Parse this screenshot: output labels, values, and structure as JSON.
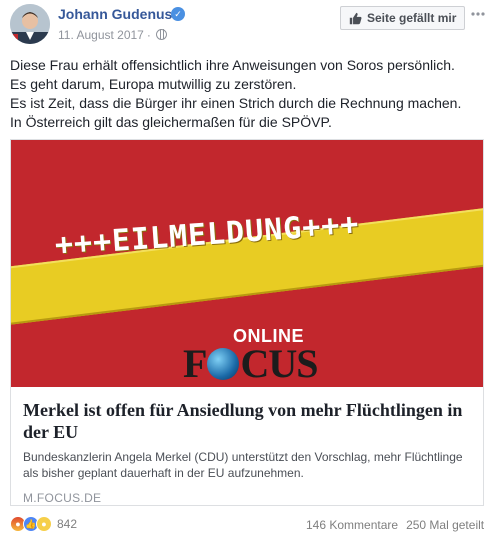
{
  "post": {
    "author": "Johann Gudenus",
    "date": "11. August 2017",
    "meta_separator": "·",
    "like_page_label": "Seite gefällt mir",
    "text_lines": [
      "Diese Frau erhält offensichtlich ihre Anweisungen von Soros persönlich.",
      "Es geht darum, Europa mutwillig zu zerstören.",
      "Es ist Zeit, dass die Bürger ihr einen Strich durch die Rechnung machen.",
      "In Österreich gilt das gleichermaßen für die SPÖVP."
    ]
  },
  "link_card": {
    "image": {
      "banner_text": "+++EILMELDUNG+++",
      "logo_top": "ONLINE",
      "logo_letters": [
        "F",
        "CUS"
      ]
    },
    "title": "Merkel ist offen für Ansiedlung von mehr Flüchtlingen in der EU",
    "description": "Bundeskanzlerin Angela Merkel (CDU) unterstützt den Vorschlag, mehr Flüchtlinge als bisher geplant dauerhaft in der EU aufzunehmen.",
    "domain": "M.FOCUS.DE"
  },
  "footer": {
    "reaction_count": "842",
    "reaction_icons": [
      "angry-icon",
      "like-icon",
      "sad-icon"
    ],
    "comments": "146 Kommentare",
    "shares": "250 Mal geteilt"
  },
  "colors": {
    "author_link": "#365899",
    "card_image_bg": "#c2272d",
    "banner_yellow": "#e8cc23",
    "muted_text": "#90949c"
  }
}
